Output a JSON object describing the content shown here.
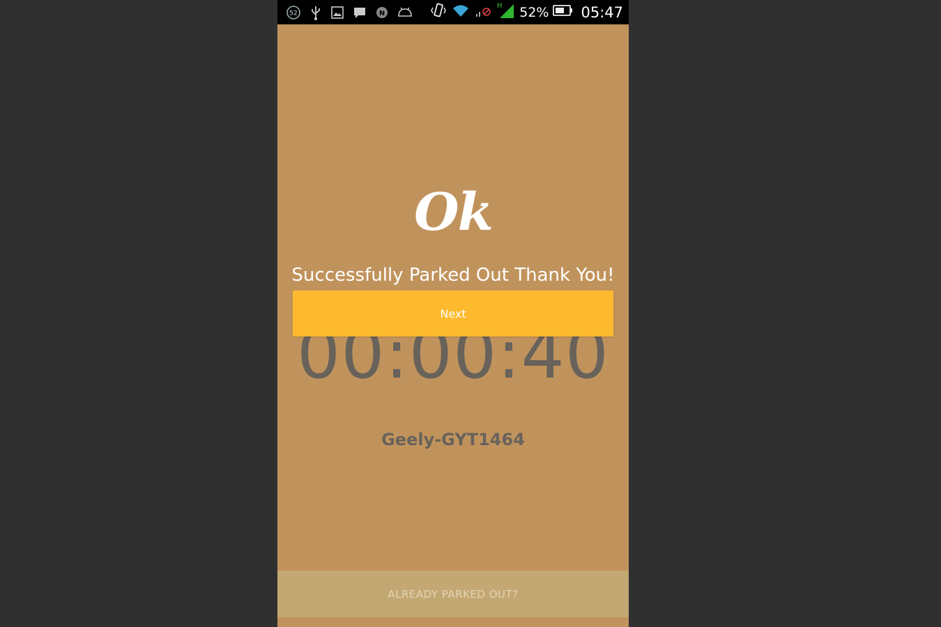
{
  "status_bar": {
    "notification_count": "52",
    "battery_percent": "52%",
    "network_type": "H",
    "time": "05:47",
    "icons": [
      "notification-count-icon",
      "usb-icon",
      "image-icon",
      "message-icon",
      "n-app-icon",
      "android-icon",
      "vibrate-icon",
      "wifi-icon",
      "no-signal-icon",
      "signal-icon",
      "battery-icon"
    ]
  },
  "screen": {
    "ok_title": "Ok",
    "success_message": "Successfully Parked Out Thank You!",
    "next_label": "Next",
    "timer": "00:00:40",
    "vehicle_plate": "Geely-GYT1464",
    "already_parked_out_label": "ALREADY PARKED OUT?"
  },
  "colors": {
    "background": "#c1935c",
    "next_button": "#feba2e",
    "timer_text": "#68625b",
    "already_bar": "#c4a873",
    "page_outer": "#303030"
  }
}
